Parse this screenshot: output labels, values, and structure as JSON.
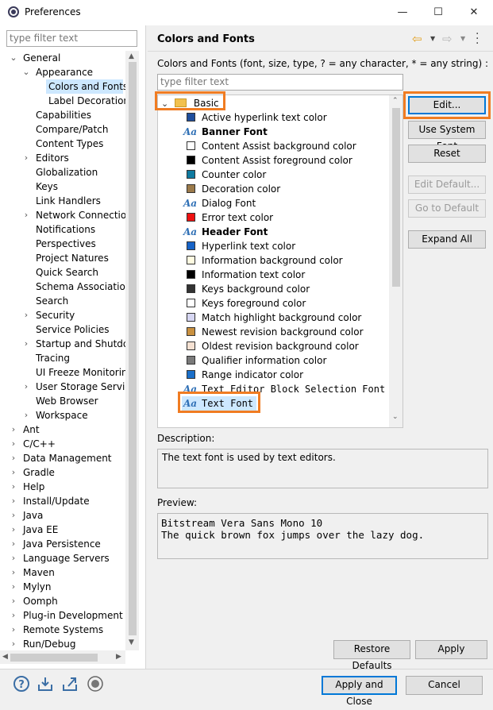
{
  "window": {
    "title": "Preferences",
    "minimize": "—",
    "maximize": "☐",
    "close": "✕"
  },
  "left": {
    "filter_placeholder": "type filter text",
    "tree": [
      {
        "label": "General",
        "indent": 0,
        "chev": "⌄"
      },
      {
        "label": "Appearance",
        "indent": 1,
        "chev": "⌄"
      },
      {
        "label": "Colors and Fonts",
        "indent": 2,
        "chev": "",
        "selected": true
      },
      {
        "label": "Label Decorations",
        "indent": 2,
        "chev": ""
      },
      {
        "label": "Capabilities",
        "indent": 1,
        "chev": ""
      },
      {
        "label": "Compare/Patch",
        "indent": 1,
        "chev": ""
      },
      {
        "label": "Content Types",
        "indent": 1,
        "chev": ""
      },
      {
        "label": "Editors",
        "indent": 1,
        "chev": "›"
      },
      {
        "label": "Globalization",
        "indent": 1,
        "chev": ""
      },
      {
        "label": "Keys",
        "indent": 1,
        "chev": ""
      },
      {
        "label": "Link Handlers",
        "indent": 1,
        "chev": ""
      },
      {
        "label": "Network Connections",
        "indent": 1,
        "chev": "›"
      },
      {
        "label": "Notifications",
        "indent": 1,
        "chev": ""
      },
      {
        "label": "Perspectives",
        "indent": 1,
        "chev": ""
      },
      {
        "label": "Project Natures",
        "indent": 1,
        "chev": ""
      },
      {
        "label": "Quick Search",
        "indent": 1,
        "chev": ""
      },
      {
        "label": "Schema Associations",
        "indent": 1,
        "chev": ""
      },
      {
        "label": "Search",
        "indent": 1,
        "chev": ""
      },
      {
        "label": "Security",
        "indent": 1,
        "chev": "›"
      },
      {
        "label": "Service Policies",
        "indent": 1,
        "chev": ""
      },
      {
        "label": "Startup and Shutdown",
        "indent": 1,
        "chev": "›"
      },
      {
        "label": "Tracing",
        "indent": 1,
        "chev": ""
      },
      {
        "label": "UI Freeze Monitoring",
        "indent": 1,
        "chev": ""
      },
      {
        "label": "User Storage Service",
        "indent": 1,
        "chev": "›"
      },
      {
        "label": "Web Browser",
        "indent": 1,
        "chev": ""
      },
      {
        "label": "Workspace",
        "indent": 1,
        "chev": "›"
      },
      {
        "label": "Ant",
        "indent": 0,
        "chev": "›"
      },
      {
        "label": "C/C++",
        "indent": 0,
        "chev": "›"
      },
      {
        "label": "Data Management",
        "indent": 0,
        "chev": "›"
      },
      {
        "label": "Gradle",
        "indent": 0,
        "chev": "›"
      },
      {
        "label": "Help",
        "indent": 0,
        "chev": "›"
      },
      {
        "label": "Install/Update",
        "indent": 0,
        "chev": "›"
      },
      {
        "label": "Java",
        "indent": 0,
        "chev": "›"
      },
      {
        "label": "Java EE",
        "indent": 0,
        "chev": "›"
      },
      {
        "label": "Java Persistence",
        "indent": 0,
        "chev": "›"
      },
      {
        "label": "Language Servers",
        "indent": 0,
        "chev": "›"
      },
      {
        "label": "Maven",
        "indent": 0,
        "chev": "›"
      },
      {
        "label": "Mylyn",
        "indent": 0,
        "chev": "›"
      },
      {
        "label": "Oomph",
        "indent": 0,
        "chev": "›"
      },
      {
        "label": "Plug-in Development",
        "indent": 0,
        "chev": "›"
      },
      {
        "label": "Remote Systems",
        "indent": 0,
        "chev": "›"
      },
      {
        "label": "Run/Debug",
        "indent": 0,
        "chev": "›"
      }
    ]
  },
  "page": {
    "title": "Colors and Fonts",
    "instructions": "Colors and Fonts (font, size, type, ? = any character, * = any string) :",
    "filter_placeholder": "type filter text",
    "category": "Basic",
    "items": [
      {
        "label": "Active hyperlink text color",
        "kind": "color",
        "color": "#1f4e9c"
      },
      {
        "label": "Banner Font",
        "kind": "font",
        "bold": true
      },
      {
        "label": "Content Assist background color",
        "kind": "color",
        "color": "#ffffff"
      },
      {
        "label": "Content Assist foreground color",
        "kind": "color",
        "color": "#000000"
      },
      {
        "label": "Counter color",
        "kind": "color",
        "color": "#0e7aa0"
      },
      {
        "label": "Decoration color",
        "kind": "color",
        "color": "#9b7a4a"
      },
      {
        "label": "Dialog Font",
        "kind": "font"
      },
      {
        "label": "Error text color",
        "kind": "color",
        "color": "#ee1111"
      },
      {
        "label": "Header Font",
        "kind": "font",
        "bold": true
      },
      {
        "label": "Hyperlink text color",
        "kind": "color",
        "color": "#1663c7"
      },
      {
        "label": "Information background color",
        "kind": "color",
        "color": "#fffbe1"
      },
      {
        "label": "Information text color",
        "kind": "color",
        "color": "#000000"
      },
      {
        "label": "Keys background color",
        "kind": "color",
        "color": "#333333"
      },
      {
        "label": "Keys foreground color",
        "kind": "color",
        "color": "#ffffff"
      },
      {
        "label": "Match highlight background color",
        "kind": "color",
        "color": "#d6d6f2"
      },
      {
        "label": "Newest revision background color",
        "kind": "color",
        "color": "#c99140"
      },
      {
        "label": "Oldest revision background color",
        "kind": "color",
        "color": "#f5e1d2"
      },
      {
        "label": "Qualifier information color",
        "kind": "color",
        "color": "#7a7a7a"
      },
      {
        "label": "Range indicator color",
        "kind": "color",
        "color": "#1a6fc9"
      },
      {
        "label": "Text Editor Block Selection Font",
        "kind": "font",
        "mono": true
      },
      {
        "label": "Text Font",
        "kind": "font",
        "mono": true,
        "selected": true
      }
    ],
    "buttons": {
      "edit": "Edit...",
      "use_system_font": "Use System Font",
      "reset": "Reset",
      "edit_default": "Edit Default...",
      "go_to_default": "Go to Default",
      "expand_all": "Expand All"
    },
    "description_label": "Description:",
    "description_text": "The text font is used by text editors.",
    "preview_label": "Preview:",
    "preview_line1": "Bitstream Vera Sans Mono 10",
    "preview_line2": "The quick brown fox jumps over the lazy dog.",
    "restore_defaults": "Restore Defaults",
    "apply": "Apply"
  },
  "footer": {
    "apply_and_close": "Apply and Close",
    "cancel": "Cancel",
    "icons": [
      "help-icon",
      "import-icon",
      "export-icon",
      "record-icon"
    ]
  },
  "colors": {
    "highlight_box": "#f07c22",
    "selection": "#cde8ff",
    "accent": "#0078d7"
  }
}
